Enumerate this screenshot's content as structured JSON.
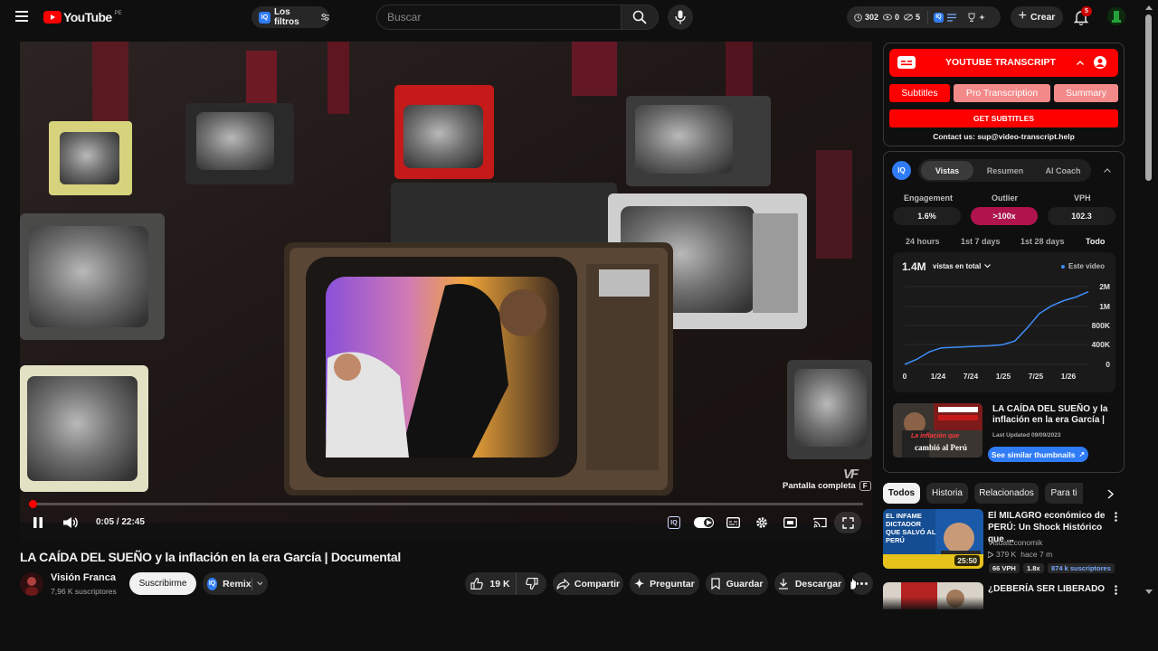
{
  "header": {
    "logo_text": "YouTube",
    "country_code": "PE",
    "filters_label": "Los filtros",
    "search_placeholder": "Buscar",
    "stats": {
      "watched": "302",
      "views_zero": "0",
      "hidden": "5"
    },
    "create_label": "Crear",
    "notifications_count": "5"
  },
  "player": {
    "watermark": "F",
    "tooltip": "Pantalla completa",
    "tooltip_key": "F",
    "time": "0:05 / 22:45",
    "progress": 0.004
  },
  "video": {
    "title": "LA CAÍDA DEL SUEÑO y la inflación en la era García | Documental",
    "channel": "Visión Franca",
    "subscribers": "7,96 K suscriptores",
    "subscribe_label": "Suscribirme",
    "remix_label": "Remix",
    "likes": "19 K",
    "share_label": "Compartir",
    "ask_label": "Preguntar",
    "save_label": "Guardar",
    "download_label": "Descargar"
  },
  "transcript_ext": {
    "title": "YOUTUBE TRANSCRIPT",
    "tabs": [
      "Subtitles",
      "Pro Transcription",
      "Summary"
    ],
    "get_button": "GET SUBTITLES",
    "contact": "Contact us: sup@video-transcript.help"
  },
  "vidiq": {
    "tabs": [
      "Vistas",
      "Resumen",
      "AI Coach"
    ],
    "metrics": [
      {
        "label": "Engagement",
        "value": "1.6%"
      },
      {
        "label": "Outlier",
        "value": ">100x"
      },
      {
        "label": "VPH",
        "value": "102.3"
      }
    ],
    "ranges": [
      "24 hours",
      "1st 7 days",
      "1st 28 days",
      "Todo"
    ],
    "active_range": "Todo",
    "total_views": "1.4M",
    "views_dropdown": "vistas en total",
    "legend": "Este video",
    "thumb_title": "LA CAÍDA DEL SUEÑO y la inflación en la era García |",
    "last_updated": "Last Updated 09/09/2023",
    "thumb_text_1": "La inflación que",
    "thumb_text_2": "cambió al Perú",
    "similar_button": "See similar thumbnails"
  },
  "chart_data": {
    "type": "line",
    "x_ticks": [
      "0",
      "1/24",
      "7/24",
      "1/25",
      "7/25",
      "1/26"
    ],
    "y_ticks": [
      "0",
      "400K",
      "800K",
      "1M",
      "2M"
    ],
    "series": [
      {
        "values": [
          0,
          100000,
          240000,
          320000,
          330000,
          340000,
          350000,
          360000,
          380000,
          450000,
          700000,
          980000,
          1130000,
          1230000,
          1300000,
          1400000
        ]
      }
    ],
    "ylim": [
      0,
      1500000
    ],
    "color": "#3e8ef7"
  },
  "rec": {
    "chips": [
      "Todos",
      "Historia",
      "Relacionados",
      "Para ti"
    ],
    "items": [
      {
        "title": "El MILAGRO económico de PERÚ: Un Shock Histórico que ...",
        "channel": "VisualEconomik",
        "views": "379 K",
        "age": "hace 7 m",
        "duration": "25:50",
        "vph": "66 VPH",
        "outlier": "1.8x",
        "subs": "874 k suscriptores",
        "thumb_text": "EL INFAME DICTADOR QUE SALVÓ AL PERÚ"
      },
      {
        "title": "¿DEBERÍA SER LIBERADO EN EL"
      }
    ]
  },
  "colors": {
    "ext_red": "#ff0000",
    "accent_blue": "#3ea6ff",
    "outlier_magenta": "#b0144d",
    "line_blue": "#3e8ef7"
  }
}
